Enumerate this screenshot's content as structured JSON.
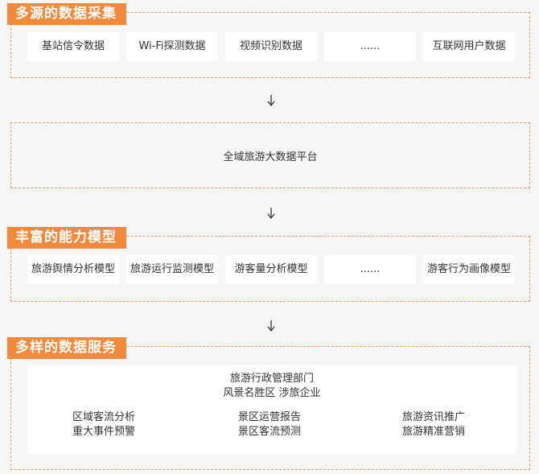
{
  "collection": {
    "title": "多源的数据采集",
    "items": [
      "基站信令数据",
      "Wi-Fi探测数据",
      "视频识别数据",
      "......",
      "互联网用户数据"
    ]
  },
  "platform": {
    "label": "全域旅游大数据平台"
  },
  "models": {
    "title": "丰富的能力模型",
    "items": [
      "旅游舆情分析模型",
      "旅游运行监测模型",
      "游客量分析模型",
      "......",
      "游客行为画像模型"
    ]
  },
  "services": {
    "title": "多样的数据服务",
    "audience_line1": "旅游行政管理部门",
    "audience_line2": "风景名胜区 涉旅企业",
    "columns": [
      {
        "line1": "区域客流分析",
        "line2": "重大事件预警"
      },
      {
        "line1": "景区运营报告",
        "line2": "景区客流预测"
      },
      {
        "line1": "旅游资讯推广",
        "line2": "旅游精准营销"
      }
    ]
  },
  "colors": {
    "accent": "#f38a3b",
    "dashed_border": "#f19a5a",
    "background": "#f6f6f6"
  },
  "icons": {
    "flow_arrow": "down-arrow-icon"
  }
}
